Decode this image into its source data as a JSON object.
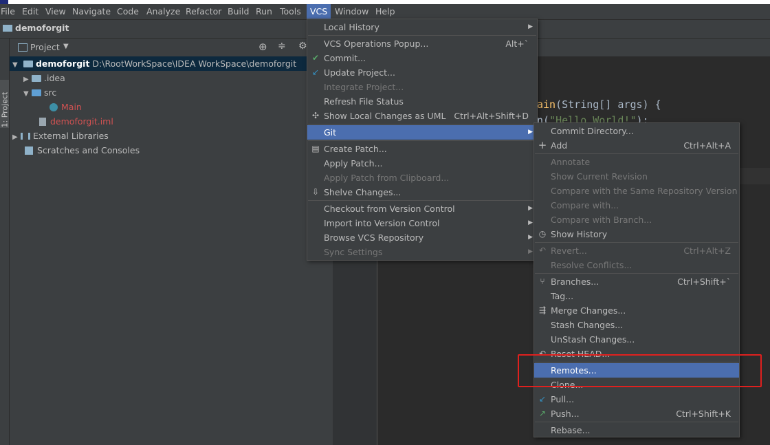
{
  "menubar": {
    "items": [
      "File",
      "Edit",
      "View",
      "Navigate",
      "Code",
      "Analyze",
      "Refactor",
      "Build",
      "Run",
      "Tools",
      "VCS",
      "Window",
      "Help"
    ],
    "active": "VCS"
  },
  "navbar": {
    "project": "demoforgit"
  },
  "toolwindow": {
    "side_tab": "1: Project",
    "header": "Project"
  },
  "tree": {
    "root_name": "demoforgit",
    "root_path": "D:\\RootWorkSpace\\IDEA WorkSpace\\demoforgit",
    "idea": ".idea",
    "src": "src",
    "main": "Main",
    "iml": "demoforgit.iml",
    "ext_libs": "External Libraries",
    "scratches": "Scratches and Consoles"
  },
  "editor": {
    "line1_fn": "ain",
    "line1_rest": "(String[] args) {",
    "line2_pre": "n(",
    "line2_str": "\"Hello World!\"",
    "line2_post": ");"
  },
  "vcs_menu": {
    "local_history": "Local History",
    "operations_popup": "VCS Operations Popup...",
    "operations_popup_sc": "Alt+`",
    "commit": "Commit...",
    "update": "Update Project...",
    "integrate": "Integrate Project...",
    "refresh": "Refresh File Status",
    "show_local": "Show Local Changes as UML",
    "show_local_sc": "Ctrl+Alt+Shift+D",
    "git": "Git",
    "create_patch": "Create Patch...",
    "apply_patch": "Apply Patch...",
    "apply_clip": "Apply Patch from Clipboard...",
    "shelve": "Shelve Changes...",
    "checkout": "Checkout from Version Control",
    "import": "Import into Version Control",
    "browse": "Browse VCS Repository",
    "sync": "Sync Settings"
  },
  "git_menu": {
    "commit_dir": "Commit Directory...",
    "add": "Add",
    "add_sc": "Ctrl+Alt+A",
    "annotate": "Annotate",
    "show_rev": "Show Current Revision",
    "compare_same": "Compare with the Same Repository Version",
    "compare_with": "Compare with...",
    "compare_branch": "Compare with Branch...",
    "show_history": "Show History",
    "revert": "Revert...",
    "revert_sc": "Ctrl+Alt+Z",
    "resolve": "Resolve Conflicts...",
    "branches": "Branches...",
    "branches_sc": "Ctrl+Shift+`",
    "tag": "Tag...",
    "merge": "Merge Changes...",
    "stash": "Stash Changes...",
    "unstash": "UnStash Changes...",
    "reset": "Reset HEAD...",
    "remotes": "Remotes...",
    "clone": "Clone...",
    "pull": "Pull...",
    "push": "Push...",
    "push_sc": "Ctrl+Shift+K",
    "rebase": "Rebase..."
  },
  "colors": {
    "highlight": "#4b6eaf",
    "annotation_box": "#e0201e",
    "selected_row": "#0d293e"
  }
}
